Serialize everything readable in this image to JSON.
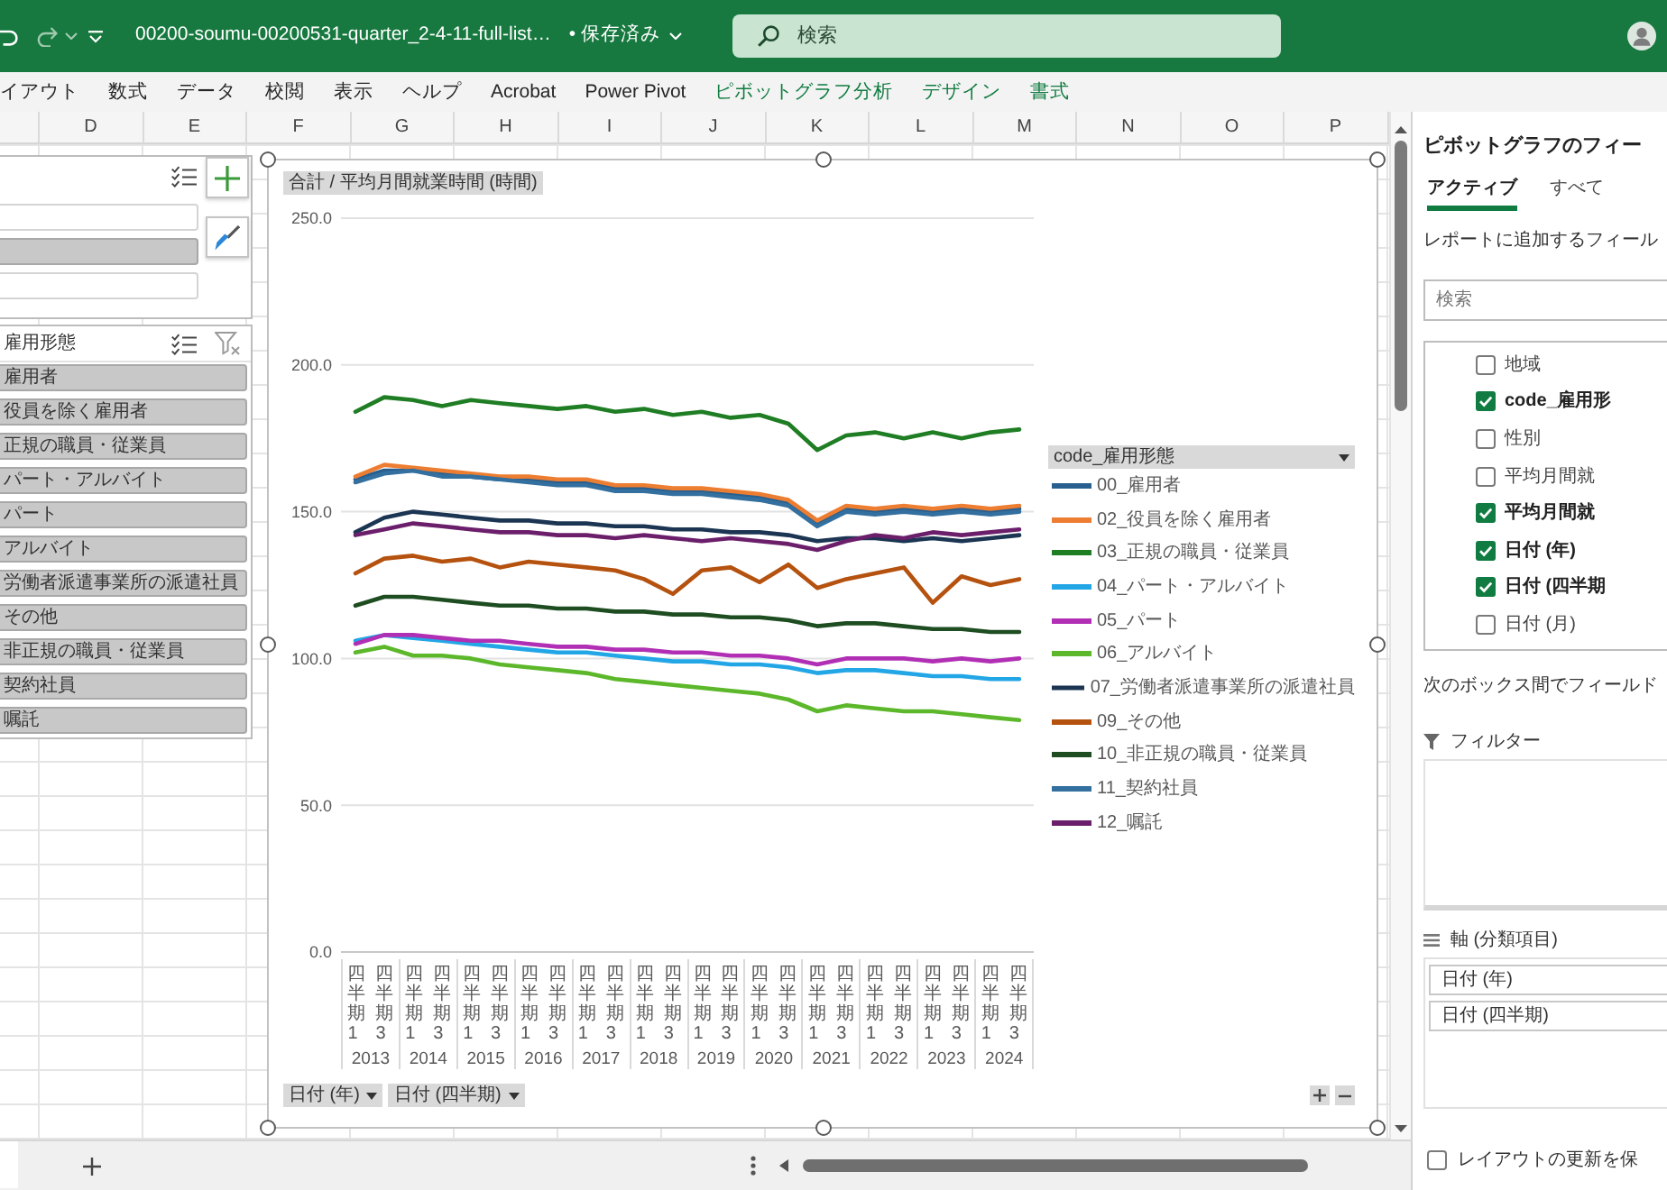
{
  "title_bar": {
    "file_name": "00200-soumu-00200531-quarter_2-4-11-full-list…",
    "save_status": "• 保存済み",
    "search_placeholder": "検索"
  },
  "ribbon_tabs": [
    {
      "label": "イアウト",
      "contextual": false,
      "selected": false
    },
    {
      "label": "数式",
      "contextual": false,
      "selected": false
    },
    {
      "label": "データ",
      "contextual": false,
      "selected": false
    },
    {
      "label": "校閲",
      "contextual": false,
      "selected": false
    },
    {
      "label": "表示",
      "contextual": false,
      "selected": false
    },
    {
      "label": "ヘルプ",
      "contextual": false,
      "selected": false
    },
    {
      "label": "Acrobat",
      "contextual": false,
      "selected": false
    },
    {
      "label": "Power Pivot",
      "contextual": false,
      "selected": false
    },
    {
      "label": "ピボットグラフ分析",
      "contextual": true,
      "selected": false
    },
    {
      "label": "デザイン",
      "contextual": true,
      "selected": false
    },
    {
      "label": "書式",
      "contextual": true,
      "selected": false
    }
  ],
  "column_headers": [
    "D",
    "E",
    "F",
    "G",
    "H",
    "I",
    "J",
    "K",
    "L",
    "M",
    "N",
    "O",
    "P"
  ],
  "slicers": [
    {
      "items": [
        {
          "selected": false
        },
        {
          "selected": true
        },
        {
          "selected": false
        }
      ]
    },
    {
      "header": "雇用形態",
      "items": [
        {
          "label": "雇用者",
          "selected": true
        },
        {
          "label": "役員を除く雇用者",
          "selected": true
        },
        {
          "label": "正規の職員・従業員",
          "selected": true
        },
        {
          "label": "パート・アルバイト",
          "selected": true
        },
        {
          "label": "パート",
          "selected": true
        },
        {
          "label": "アルバイト",
          "selected": true
        },
        {
          "label": "労働者派遣事業所の派遣社員",
          "selected": true
        },
        {
          "label": "その他",
          "selected": true
        },
        {
          "label": "非正規の職員・従業員",
          "selected": true
        },
        {
          "label": "契約社員",
          "selected": true
        },
        {
          "label": "嘱託",
          "selected": true
        }
      ]
    }
  ],
  "chart": {
    "value_button": "合計 / 平均月間就業時間 (時間)",
    "legend_button": "code_雇用形態",
    "axis_buttons": [
      "日付 (年)",
      "日付 (四半期)"
    ],
    "axis_group_labels": [
      "2013",
      "2014",
      "2015",
      "2016",
      "2017",
      "2018",
      "2019",
      "2020",
      "2021",
      "2022",
      "2023",
      "2024"
    ],
    "chart_data": {
      "type": "line",
      "categories": [
        "四半期1",
        "四半期3",
        "四半期1",
        "四半期3",
        "四半期1",
        "四半期3",
        "四半期1",
        "四半期3",
        "四半期1",
        "四半期3",
        "四半期1",
        "四半期3",
        "四半期1",
        "四半期3",
        "四半期1",
        "四半期3",
        "四半期1",
        "四半期3",
        "四半期1",
        "四半期3",
        "四半期1",
        "四半期3",
        "四半期1",
        "四半期3"
      ],
      "ylim": [
        0,
        250
      ],
      "yticks": [
        {
          "value": 0,
          "label": "0.0"
        },
        {
          "value": 50,
          "label": "50.0"
        },
        {
          "value": 100,
          "label": "100.0"
        },
        {
          "value": 150,
          "label": "150.0"
        },
        {
          "value": 200,
          "label": "200.0"
        },
        {
          "value": 250,
          "label": "250.0"
        }
      ],
      "grid": true,
      "legend": true,
      "series": [
        {
          "name": "00_雇用者",
          "color": "#285f8f",
          "values": [
            161,
            164,
            164,
            163,
            162,
            161,
            161,
            160,
            160,
            158,
            158,
            157,
            157,
            156,
            155,
            153,
            146,
            151,
            150,
            151,
            150,
            151,
            150,
            151
          ]
        },
        {
          "name": "02_役員を除く雇用者",
          "color": "#ed7d31",
          "values": [
            162,
            166,
            165,
            164,
            163,
            162,
            162,
            161,
            161,
            159,
            159,
            158,
            158,
            157,
            156,
            154,
            147,
            152,
            151,
            152,
            151,
            152,
            151,
            152
          ]
        },
        {
          "name": "03_正規の職員・従業員",
          "color": "#1f7d24",
          "values": [
            184,
            189,
            188,
            186,
            188,
            187,
            186,
            185,
            186,
            184,
            185,
            183,
            184,
            182,
            183,
            180,
            171,
            176,
            177,
            175,
            177,
            175,
            177,
            178
          ]
        },
        {
          "name": "04_パート・アルバイト",
          "color": "#22a6e6",
          "values": [
            106,
            108,
            107,
            106,
            105,
            104,
            103,
            102,
            102,
            101,
            100,
            99,
            99,
            98,
            98,
            97,
            95,
            96,
            96,
            95,
            94,
            94,
            93,
            93
          ]
        },
        {
          "name": "05_パート",
          "color": "#b12fb4",
          "values": [
            105,
            108,
            108,
            107,
            106,
            106,
            105,
            104,
            104,
            103,
            103,
            102,
            102,
            101,
            101,
            100,
            98,
            100,
            100,
            100,
            99,
            100,
            99,
            100
          ]
        },
        {
          "name": "06_アルバイト",
          "color": "#5cb82a",
          "values": [
            102,
            104,
            101,
            101,
            100,
            98,
            97,
            96,
            95,
            93,
            92,
            91,
            90,
            89,
            88,
            86,
            82,
            84,
            83,
            82,
            82,
            81,
            80,
            79
          ]
        },
        {
          "name": "07_労働者派遣事業所の派遣社員",
          "color": "#1b3553",
          "values": [
            143,
            148,
            150,
            149,
            148,
            147,
            147,
            146,
            146,
            145,
            145,
            144,
            144,
            143,
            143,
            142,
            140,
            141,
            141,
            140,
            141,
            140,
            141,
            142
          ]
        },
        {
          "name": "09_その他",
          "color": "#b5520f",
          "values": [
            129,
            134,
            135,
            133,
            134,
            131,
            133,
            132,
            131,
            130,
            127,
            122,
            130,
            131,
            126,
            132,
            124,
            127,
            129,
            131,
            119,
            128,
            125,
            127
          ]
        },
        {
          "name": "10_非正規の職員・従業員",
          "color": "#1d4d20",
          "values": [
            118,
            121,
            121,
            120,
            119,
            118,
            118,
            117,
            117,
            116,
            116,
            115,
            115,
            114,
            114,
            113,
            111,
            112,
            112,
            111,
            110,
            110,
            109,
            109
          ]
        },
        {
          "name": "11_契約社員",
          "color": "#33709f",
          "values": [
            160,
            163,
            164,
            162,
            162,
            161,
            160,
            159,
            159,
            157,
            157,
            156,
            156,
            155,
            154,
            152,
            145,
            150,
            149,
            150,
            149,
            150,
            149,
            150
          ]
        },
        {
          "name": "12_嘱託",
          "color": "#6b1f6b",
          "values": [
            142,
            144,
            146,
            145,
            144,
            143,
            143,
            142,
            142,
            141,
            142,
            141,
            140,
            141,
            140,
            139,
            137,
            140,
            142,
            141,
            143,
            142,
            143,
            144
          ]
        }
      ]
    }
  },
  "field_pane": {
    "title": "ピボットグラフのフィー",
    "tabs": [
      {
        "label": "アクティブ",
        "selected": true
      },
      {
        "label": "すべて",
        "selected": false
      }
    ],
    "instruction": "レポートに追加するフィール",
    "search_placeholder": "検索",
    "fields": [
      {
        "label": "地域",
        "checked": false
      },
      {
        "label": "code_雇用形",
        "checked": true
      },
      {
        "label": "性別",
        "checked": false
      },
      {
        "label": "平均月間就",
        "checked": false
      },
      {
        "label": "平均月間就",
        "checked": true
      },
      {
        "label": "日付 (年)",
        "checked": true
      },
      {
        "label": "日付 (四半期",
        "checked": true
      },
      {
        "label": "日付 (月)",
        "checked": false
      }
    ],
    "areas_hint": "次のボックス間でフィールド",
    "filter_label": "フィルター",
    "axis_label": "軸 (分類項目)",
    "axis_fields": [
      "日付 (年)",
      "日付 (四半期)"
    ],
    "defer_update": {
      "label": "レイアウトの更新を保",
      "checked": false
    }
  }
}
